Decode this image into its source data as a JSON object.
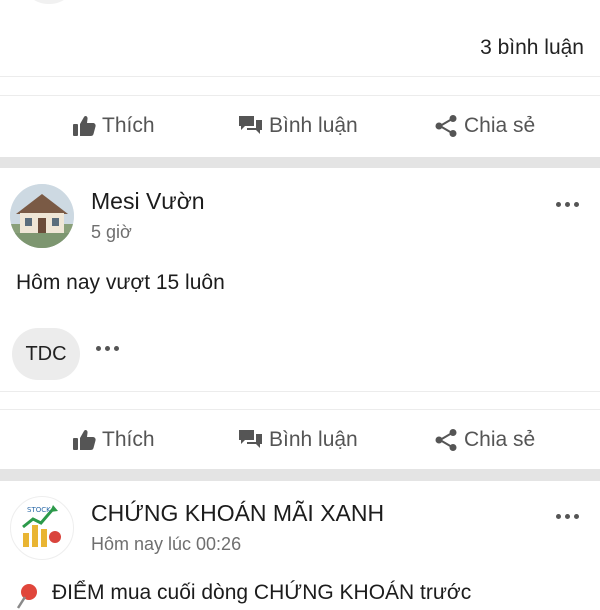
{
  "top_post": {
    "comments_count": "3 bình luận"
  },
  "actions": {
    "like": "Thích",
    "comment": "Bình luận",
    "share": "Chia sẻ"
  },
  "post1": {
    "author": "Mesi Vườn",
    "time": "5 giờ",
    "text": "Hôm nay vượt 15 luôn",
    "reaction_chip": "TDC"
  },
  "post2": {
    "author": "CHỨNG KHOÁN MÃI XANH",
    "time": "Hôm nay lúc 00:26",
    "text": "ĐIỂM mua cuối dòng CHỨNG KHOÁN trước"
  },
  "colors": {
    "separator": "#e4e4e4",
    "action_text": "#555555",
    "time_text": "#6f6f6f",
    "pin": "#e0463b"
  },
  "icons": [
    "thumbs-up-icon",
    "comment-icon",
    "share-icon",
    "more-icon",
    "pin-icon"
  ]
}
